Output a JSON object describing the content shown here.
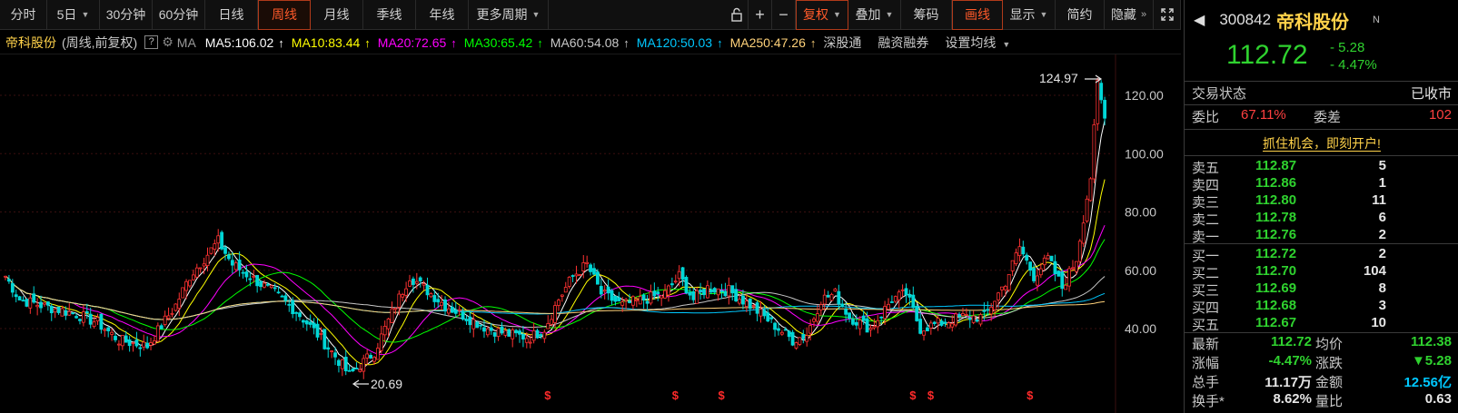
{
  "toolbar": {
    "intraday": "分时",
    "day5": "5日",
    "min30": "30分钟",
    "min60": "60分钟",
    "daily": "日线",
    "weekly": "周线",
    "monthly": "月线",
    "quarterly": "季线",
    "yearly": "年线",
    "more_periods": "更多周期",
    "adjust": "复权",
    "overlay": "叠加",
    "chips": "筹码",
    "draw_line": "画线",
    "display": "显示",
    "simple": "简约",
    "hide": "隐藏"
  },
  "ma_row": {
    "stock_name": "帝科股份",
    "mode": "(周线,前复权)",
    "help": "?",
    "ma_label": "MA",
    "ma5": "MA5:106.02",
    "ma10": "MA10:83.44",
    "ma20": "MA20:72.65",
    "ma30": "MA30:65.42",
    "ma60": "MA60:54.08",
    "ma120": "MA120:50.03",
    "ma250": "MA250:47.26",
    "link_sz": "深股通",
    "link_margin": "融资融券",
    "set_ma": "设置均线"
  },
  "colors": {
    "ma5": "#ffffff",
    "ma10": "#ffff00",
    "ma20": "#ff00ff",
    "ma30": "#00ff00",
    "ma60": "#c8c8c8",
    "ma120": "#00c8ff",
    "ma250": "#ffd27a",
    "up": "#ff3232",
    "down": "#00d6d6",
    "accent": "#ff5a2a"
  },
  "chart_data": {
    "type": "candlestick",
    "y_ticks": [
      "120.00",
      "100.00",
      "80.00",
      "60.00",
      "40.00"
    ],
    "ylim": [
      35,
      125
    ],
    "high_label": "124.97",
    "low_label": "20.69",
    "marker_symbol": "$",
    "markers": [
      153,
      189,
      202,
      256,
      261,
      289
    ]
  },
  "panel": {
    "code": "300842",
    "name": "帝科股份",
    "n_mark": "N",
    "price": "112.72",
    "change": "- 5.28",
    "change_pct": "- 4.47%",
    "trade_status_label": "交易状态",
    "trade_status": "已收市",
    "wb_label": "委比",
    "wb_value": "67.11%",
    "wc_label": "委差",
    "wc_value": "102",
    "ad_text": "抓住机会，即刻开户!",
    "asks": [
      {
        "label": "卖五",
        "price": "112.87",
        "vol": "5"
      },
      {
        "label": "卖四",
        "price": "112.86",
        "vol": "1"
      },
      {
        "label": "卖三",
        "price": "112.80",
        "vol": "11"
      },
      {
        "label": "卖二",
        "price": "112.78",
        "vol": "6"
      },
      {
        "label": "卖一",
        "price": "112.76",
        "vol": "2"
      }
    ],
    "bids": [
      {
        "label": "买一",
        "price": "112.72",
        "vol": "2"
      },
      {
        "label": "买二",
        "price": "112.70",
        "vol": "104"
      },
      {
        "label": "买三",
        "price": "112.69",
        "vol": "8"
      },
      {
        "label": "买四",
        "price": "112.68",
        "vol": "3"
      },
      {
        "label": "买五",
        "price": "112.67",
        "vol": "10"
      }
    ],
    "stats": [
      {
        "l1": "最新",
        "v1": "112.72",
        "l2": "均价",
        "v2": "112.38"
      },
      {
        "l1": "涨幅",
        "v1": "-4.47%",
        "l2": "涨跌",
        "v2": "▼5.28"
      },
      {
        "l1": "总手",
        "v1": "11.17万",
        "l2": "金额",
        "v2": "12.56亿"
      },
      {
        "l1": "换手*",
        "v1": "8.62%",
        "l2": "量比",
        "v2": "0.63"
      }
    ]
  }
}
